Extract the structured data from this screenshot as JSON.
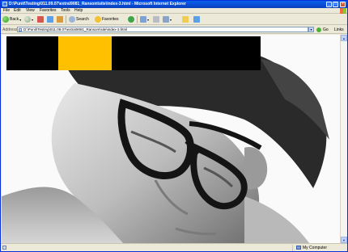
{
  "window": {
    "title": "D:\\Punit\\Testing\\011.09.07\\extra\\9081_Ransom\\site\\index-3.html - Microsoft Internet Explorer"
  },
  "menu": {
    "items": [
      {
        "label": "File"
      },
      {
        "label": "Edit"
      },
      {
        "label": "View"
      },
      {
        "label": "Favorites"
      },
      {
        "label": "Tools"
      },
      {
        "label": "Help"
      }
    ]
  },
  "toolbar": {
    "back_label": "Back",
    "search_label": "Search",
    "favorites_label": "Favorites"
  },
  "address": {
    "label": "Address",
    "value": "D:\\Punit\\Testing\\011.09.07\\extra\\9081_Ransom\\site\\index-3.html",
    "go_label": "Go",
    "links_label": "Links"
  },
  "page": {
    "header_colors": {
      "strip": "#000000",
      "accent": "#ffc000"
    },
    "photo_desc_icon": "portrait-photo"
  },
  "status": {
    "zone_label": "My Computer"
  },
  "colors": {
    "titlebar": "#0b4bd3",
    "chrome": "#ece9d8",
    "accent": "#ffc000"
  }
}
